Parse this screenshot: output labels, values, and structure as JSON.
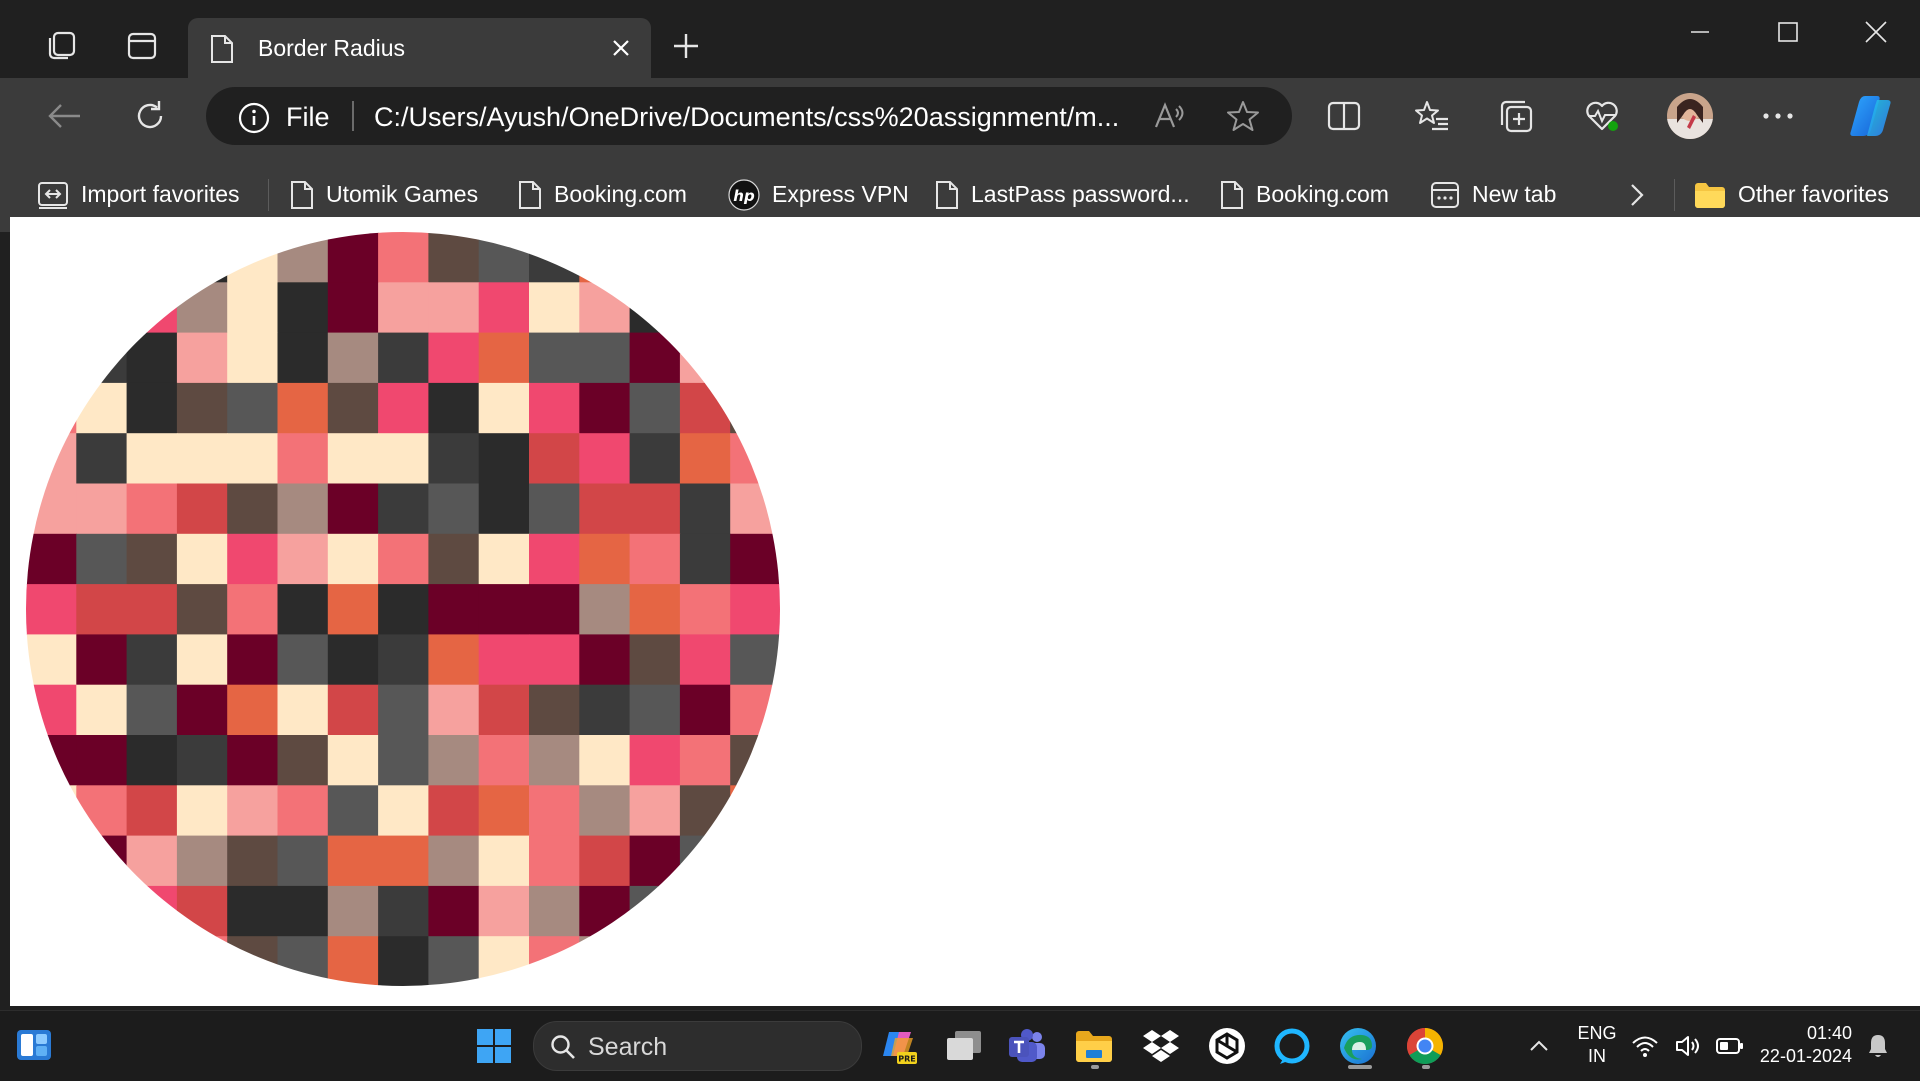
{
  "browser": {
    "tab": {
      "title": "Border Radius"
    },
    "address": {
      "scheme": "File",
      "url": "C:/Users/Ayush/OneDrive/Documents/css%20assignment/m..."
    },
    "favorites": [
      {
        "label": "Import favorites",
        "icon": "import-favorites-icon"
      },
      {
        "label": "Utomik Games",
        "icon": "page-icon"
      },
      {
        "label": "Booking.com",
        "icon": "page-icon"
      },
      {
        "label": "Express VPN",
        "icon": "hp-icon"
      },
      {
        "label": "LastPass password...",
        "icon": "page-icon"
      },
      {
        "label": "Booking.com",
        "icon": "page-icon"
      },
      {
        "label": "New tab",
        "icon": "new-tab-page-icon"
      }
    ],
    "other_favorites": "Other favorites"
  },
  "page": {
    "mosaic": {
      "shape": "circle",
      "palette": [
        "#6b0027",
        "#f0486f",
        "#2b2b2b",
        "#3b3b3b",
        "#575757",
        "#ffe8c6",
        "#a68a80",
        "#5e4a41",
        "#d24648",
        "#e56544",
        "#f37277",
        "#f6a19e"
      ]
    }
  },
  "taskbar": {
    "search_placeholder": "Search",
    "language": {
      "line1": "ENG",
      "line2": "IN"
    },
    "clock": {
      "time": "01:40",
      "date": "22-01-2024"
    }
  }
}
